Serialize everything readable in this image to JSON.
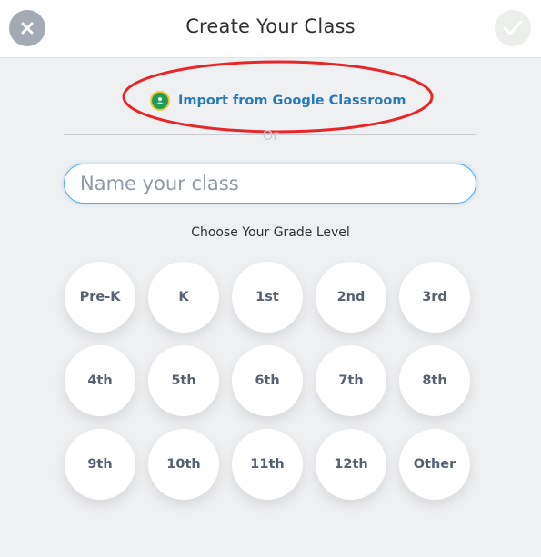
{
  "header": {
    "title": "Create Your Class",
    "close_icon": "close-x-icon",
    "done_icon": "checkmark-icon"
  },
  "import": {
    "label": "Import from Google Classroom",
    "icon": "google-classroom-icon",
    "colors": {
      "icon_bg": "#1f9d55",
      "icon_ring": "#f4c430",
      "text": "#2a7ab8",
      "annotation": "#e8262a"
    }
  },
  "separator": {
    "label": "Or"
  },
  "class_name": {
    "placeholder": "Name your class",
    "value": ""
  },
  "grade_section": {
    "title": "Choose Your Grade Level",
    "grades": [
      "Pre-K",
      "K",
      "1st",
      "2nd",
      "3rd",
      "4th",
      "5th",
      "6th",
      "7th",
      "8th",
      "9th",
      "10th",
      "11th",
      "12th",
      "Other"
    ]
  }
}
